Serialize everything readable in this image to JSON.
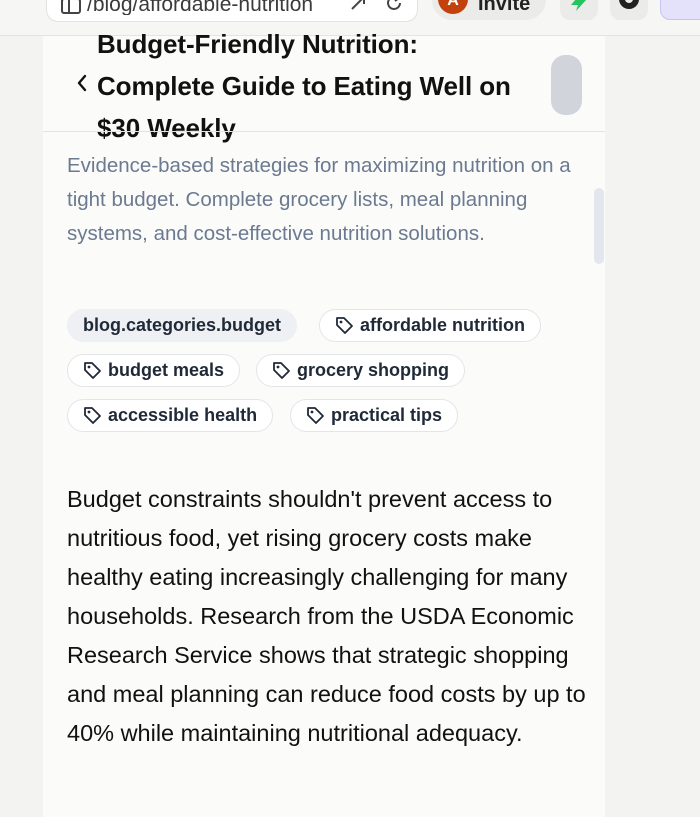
{
  "browser": {
    "url": "/blog/affordable-nutrition",
    "invite_label": "Invite",
    "avatar_initial": "A"
  },
  "article": {
    "title": "Budget-Friendly Nutrition: Complete Guide to Eating Well on $30 Weekly",
    "subtitle": "Evidence-based strategies for maximizing nutrition on a tight budget. Complete grocery lists, meal planning systems, and cost-effective nutrition solutions.",
    "category": "blog.categories.budget",
    "tags": [
      "affordable nutrition",
      "budget meals",
      "grocery shopping",
      "accessible health",
      "practical tips"
    ],
    "body": "Budget constraints shouldn't prevent access to nutritious food, yet rising grocery costs make healthy eating increasingly challenging for many households. Research from the USDA Economic Research Service shows that strategic shopping and meal planning can reduce food costs by up to 40% while maintaining nutritional adequacy."
  },
  "colors": {
    "accent_green": "#22c55e",
    "avatar": "#c2410c",
    "subtitle": "#6b7a90"
  },
  "icons": [
    "chevron-left-icon",
    "tag-icon",
    "reload-icon",
    "share-icon",
    "bolt-icon",
    "github-icon"
  ]
}
